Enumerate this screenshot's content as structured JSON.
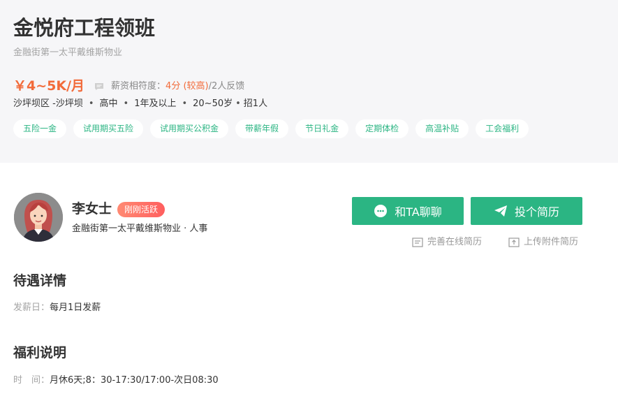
{
  "job": {
    "title": "金悦府工程领班",
    "company": "金融街第一太平戴维斯物业",
    "salary": "￥4~5K/月",
    "match_label": "薪资相符度：",
    "match_value": "4分 (较高)",
    "match_feedback": " /2人反馈",
    "meta": {
      "location": "沙坪坝区 -沙坪坝",
      "education": "高中",
      "experience": "1年及以上",
      "age": "20~50岁",
      "headcount": "招1人"
    },
    "tags": [
      "五险一金",
      "试用期买五险",
      "试用期买公积金",
      "带薪年假",
      "节日礼金",
      "定期体检",
      "高温补贴",
      "工会福利"
    ]
  },
  "recruiter": {
    "name": "李女士",
    "badge": "刚刚活跃",
    "subtitle": "金融街第一太平戴维斯物业 · 人事"
  },
  "actions": {
    "chat_label": "和TA聊聊",
    "apply_label": "投个简历",
    "online_resume_label": "完善在线简历",
    "attach_resume_label": "上传附件简历"
  },
  "sections": {
    "pay_title": "待遇详情",
    "pay_day_key": "发薪日：",
    "pay_day_value": "每月1日发薪",
    "welfare_title": "福利说明",
    "time_key": "时　间：",
    "time_value": "月休6天;8：30-17:30/17:00-次日08:30"
  },
  "colors": {
    "accent": "#2bb583",
    "salary": "#f26b3a",
    "header_bg": "#f6f6f8"
  }
}
